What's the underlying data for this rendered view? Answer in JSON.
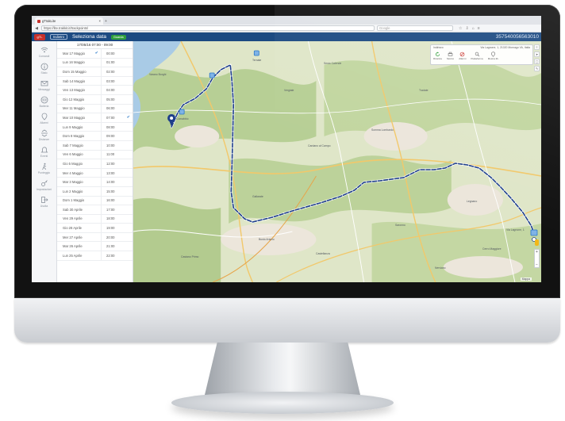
{
  "browser": {
    "tab_title": "gTrakLite",
    "tab_close": "×",
    "new_tab": "+",
    "url": "https://lite.trakkit.it/trackpoints/",
    "search_placeholder": "Google"
  },
  "app": {
    "logo_label": "gTL",
    "back_label": "Indietro",
    "title": "Seleziona data",
    "go_label": "Guarda",
    "device_id": "357540056563010"
  },
  "nav": [
    {
      "label": "Comandi",
      "icon": "wifi-icon"
    },
    {
      "label": "Stato",
      "icon": "info-icon"
    },
    {
      "label": "Messaggi",
      "icon": "envelope-icon"
    },
    {
      "label": "Batteria",
      "icon": "battery-icon"
    },
    {
      "label": "Allarmi",
      "icon": "pin-icon"
    },
    {
      "label": "Distanze",
      "icon": "arrows-icon"
    },
    {
      "label": "Eventi",
      "icon": "bell-icon"
    },
    {
      "label": "Punteggio",
      "icon": "walker-icon"
    },
    {
      "label": "Impostazioni",
      "icon": "key-icon"
    },
    {
      "label": "Uscita",
      "icon": "logout-icon"
    }
  ],
  "datelist": {
    "header": "17/05/16 07:00 - 09:00",
    "dates": [
      "Mar 17 Maggio",
      "Lun 16 Maggio",
      "Dom 15 Maggio",
      "Sab 14 Maggio",
      "Ven 13 Maggio",
      "Gio 12 Maggio",
      "Mer 11 Maggio",
      "Mar 10 Maggio",
      "Lun 9 Maggio",
      "Dom 8 Maggio",
      "Sab 7 Maggio",
      "Ven 6 Maggio",
      "Gio 5 Maggio",
      "Mer 4 Maggio",
      "Mar 3 Maggio",
      "Lun 2 Maggio",
      "Dom 1 Maggio",
      "Sab 30 Aprile",
      "Ven 29 Aprile",
      "Gio 28 Aprile",
      "Mer 27 Aprile",
      "Mar 26 Aprile",
      "Lun 25 Aprile"
    ],
    "times": [
      "00:00",
      "01:00",
      "02:00",
      "03:00",
      "04:00",
      "05:00",
      "06:00",
      "07:00",
      "08:00",
      "09:00",
      "10:00",
      "11:00",
      "12:00",
      "13:00",
      "14:00",
      "15:00",
      "16:00",
      "17:00",
      "18:00",
      "19:00",
      "20:00",
      "21:00",
      "22:00"
    ],
    "checked_date_index": 0,
    "checked_time_index": 7
  },
  "map": {
    "start_label": "Comabbio",
    "end_label": "Via Lagnone, 1",
    "places": [
      {
        "name": "Ternate"
      },
      {
        "name": "Varano Borghi"
      },
      {
        "name": "Vergiate"
      },
      {
        "name": "Sesto Calende"
      },
      {
        "name": "Somma Lombardo"
      },
      {
        "name": "Cardano al Campo"
      },
      {
        "name": "Gallarate"
      },
      {
        "name": "Busto Arsizio"
      },
      {
        "name": "Castellanza"
      },
      {
        "name": "Legnano"
      },
      {
        "name": "Cerro Maggiore"
      },
      {
        "name": "Saronno"
      },
      {
        "name": "Tradate"
      },
      {
        "name": "Castano Primo"
      },
      {
        "name": "Nerviano"
      }
    ],
    "toolbox": {
      "title": "Indirizzo",
      "address": "Via Lagnone, 1, 21020 Mornago VA, Italia",
      "buttons": [
        "Ricarica",
        "Storico",
        "Allarmi",
        "Piattaforma",
        "Mostra lib."
      ]
    },
    "map_type": "Mappa"
  },
  "colors": {
    "header": "#1c4a82",
    "accent": "#2a78c8",
    "route": "#1e3f8a",
    "go_button": "#2f9e3c"
  }
}
